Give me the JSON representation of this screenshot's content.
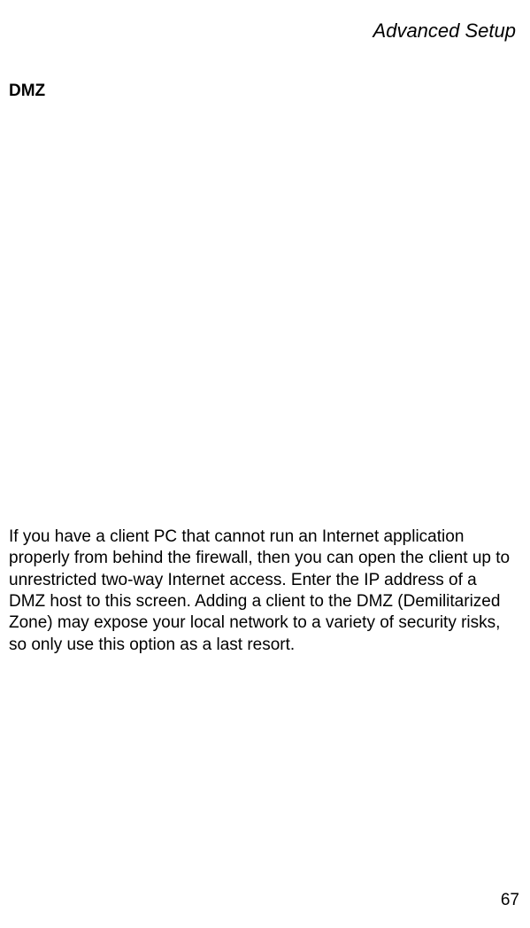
{
  "header": {
    "title": "Advanced Setup"
  },
  "section": {
    "heading": "DMZ",
    "body": "If you have a client PC that cannot run an Internet application properly from behind the firewall, then you can open the client up to unrestricted two-way Internet access. Enter the IP address of a DMZ host to this screen. Adding a client to the DMZ (Demilitarized Zone) may expose your local network to a variety of security risks, so only use this option as a last resort."
  },
  "footer": {
    "page_number": "67"
  }
}
